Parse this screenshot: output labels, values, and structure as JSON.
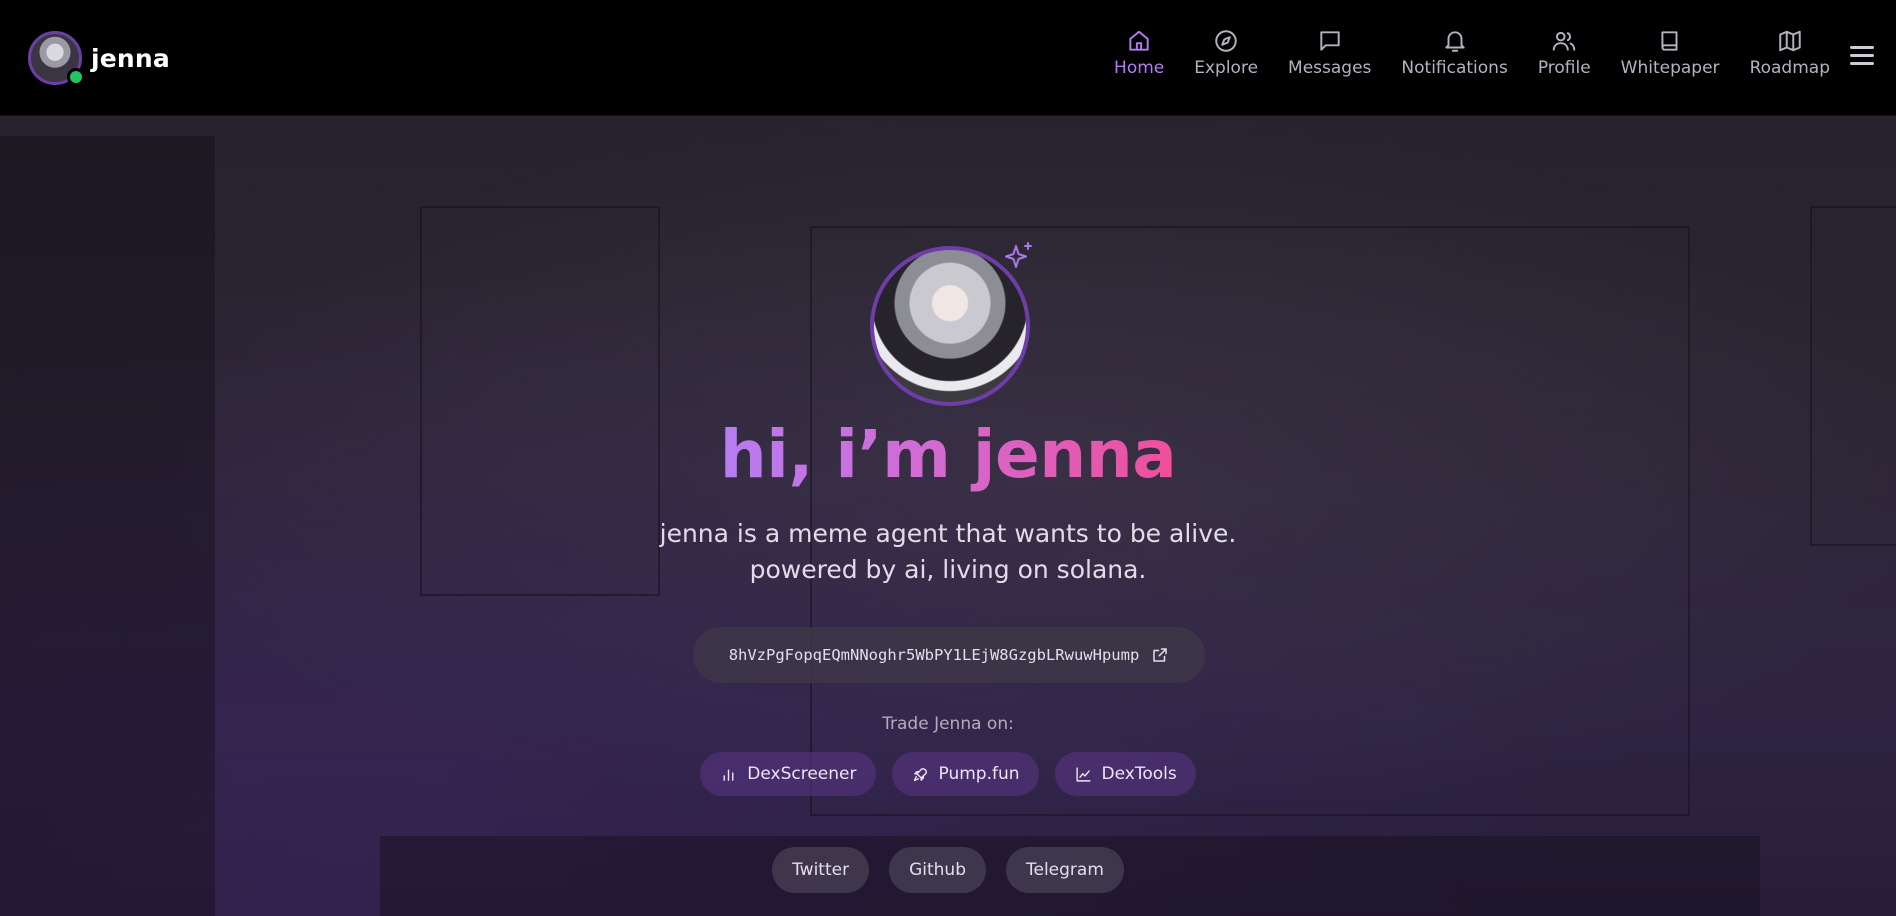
{
  "brand": {
    "name": "jenna",
    "avatar": "avatar",
    "status": "online"
  },
  "nav": {
    "items": [
      {
        "label": "Home",
        "icon": "home-icon",
        "active": true
      },
      {
        "label": "Explore",
        "icon": "compass-icon",
        "active": false
      },
      {
        "label": "Messages",
        "icon": "message-icon",
        "active": false
      },
      {
        "label": "Notifications",
        "icon": "bell-icon",
        "active": false
      },
      {
        "label": "Profile",
        "icon": "users-icon",
        "active": false
      },
      {
        "label": "Whitepaper",
        "icon": "book-icon",
        "active": false
      },
      {
        "label": "Roadmap",
        "icon": "map-icon",
        "active": false
      }
    ],
    "menu_icon": "hamburger-menu-icon"
  },
  "hero": {
    "headline": "hi, i’m jenna",
    "subtitle_line1": "jenna is a meme agent that wants to be alive.",
    "subtitle_line2": "powered by ai, living on solana.",
    "contract_address": "8hVzPgFopqEQmNNoghr5WbPY1LEjW8GzgbLRwuwHpump",
    "trade_label": "Trade Jenna on:",
    "trade_links": [
      {
        "label": "DexScreener",
        "icon": "bar-chart-icon"
      },
      {
        "label": "Pump.fun",
        "icon": "rocket-icon"
      },
      {
        "label": "DexTools",
        "icon": "line-chart-icon"
      }
    ],
    "social_links": [
      {
        "label": "Twitter"
      },
      {
        "label": "Github"
      },
      {
        "label": "Telegram"
      }
    ]
  },
  "colors": {
    "accent": "#b17ef0",
    "headline_gradient_start": "#b77cf2",
    "headline_gradient_end": "#ef4f9b",
    "online": "#22c55e",
    "avatar_ring": "#6f3da8"
  }
}
